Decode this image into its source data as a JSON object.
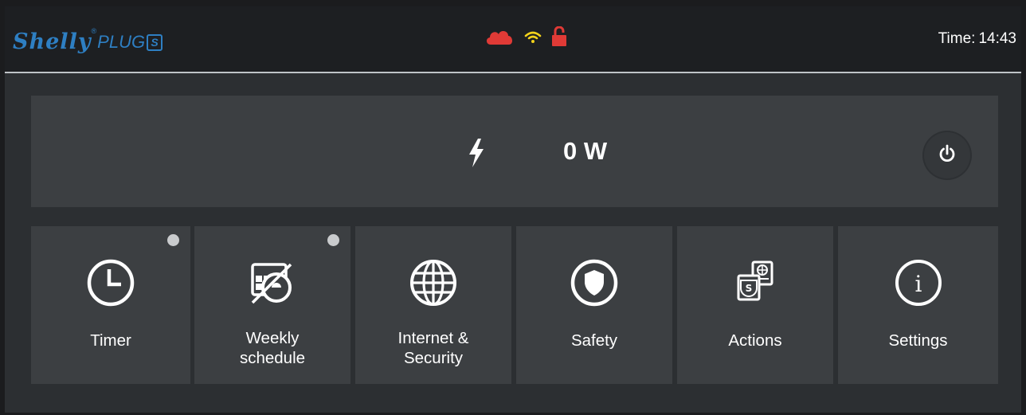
{
  "header": {
    "logo": {
      "brand": "Shelly",
      "registered": "®",
      "model": "PLUG",
      "model_suffix": "S"
    },
    "status_icons": [
      "cloud-icon",
      "wifi-icon",
      "unlocked-icon"
    ],
    "status_colors": {
      "cloud": "#e03a36",
      "wifi": "#f2d21b",
      "lock": "#e03a36"
    },
    "time_label": "Time:",
    "time_value": "14:43"
  },
  "power": {
    "icon": "bolt-icon",
    "value": "0 W",
    "button_icon": "power-icon"
  },
  "tiles": [
    {
      "label": "Timer",
      "icon": "clock-icon",
      "indicator": true
    },
    {
      "label": "Weekly\nschedule",
      "icon": "schedule-icon",
      "indicator": true
    },
    {
      "label": "Internet &\nSecurity",
      "icon": "globe-icon",
      "indicator": false
    },
    {
      "label": "Safety",
      "icon": "shield-icon",
      "indicator": false
    },
    {
      "label": "Actions",
      "icon": "actions-icon",
      "indicator": false
    },
    {
      "label": "Settings",
      "icon": "info-icon",
      "indicator": false
    }
  ],
  "colors": {
    "accent": "#2e7fc3",
    "panel": "#3c3f42",
    "background": "#2c2f32",
    "indicator": "#c9cbcd"
  }
}
